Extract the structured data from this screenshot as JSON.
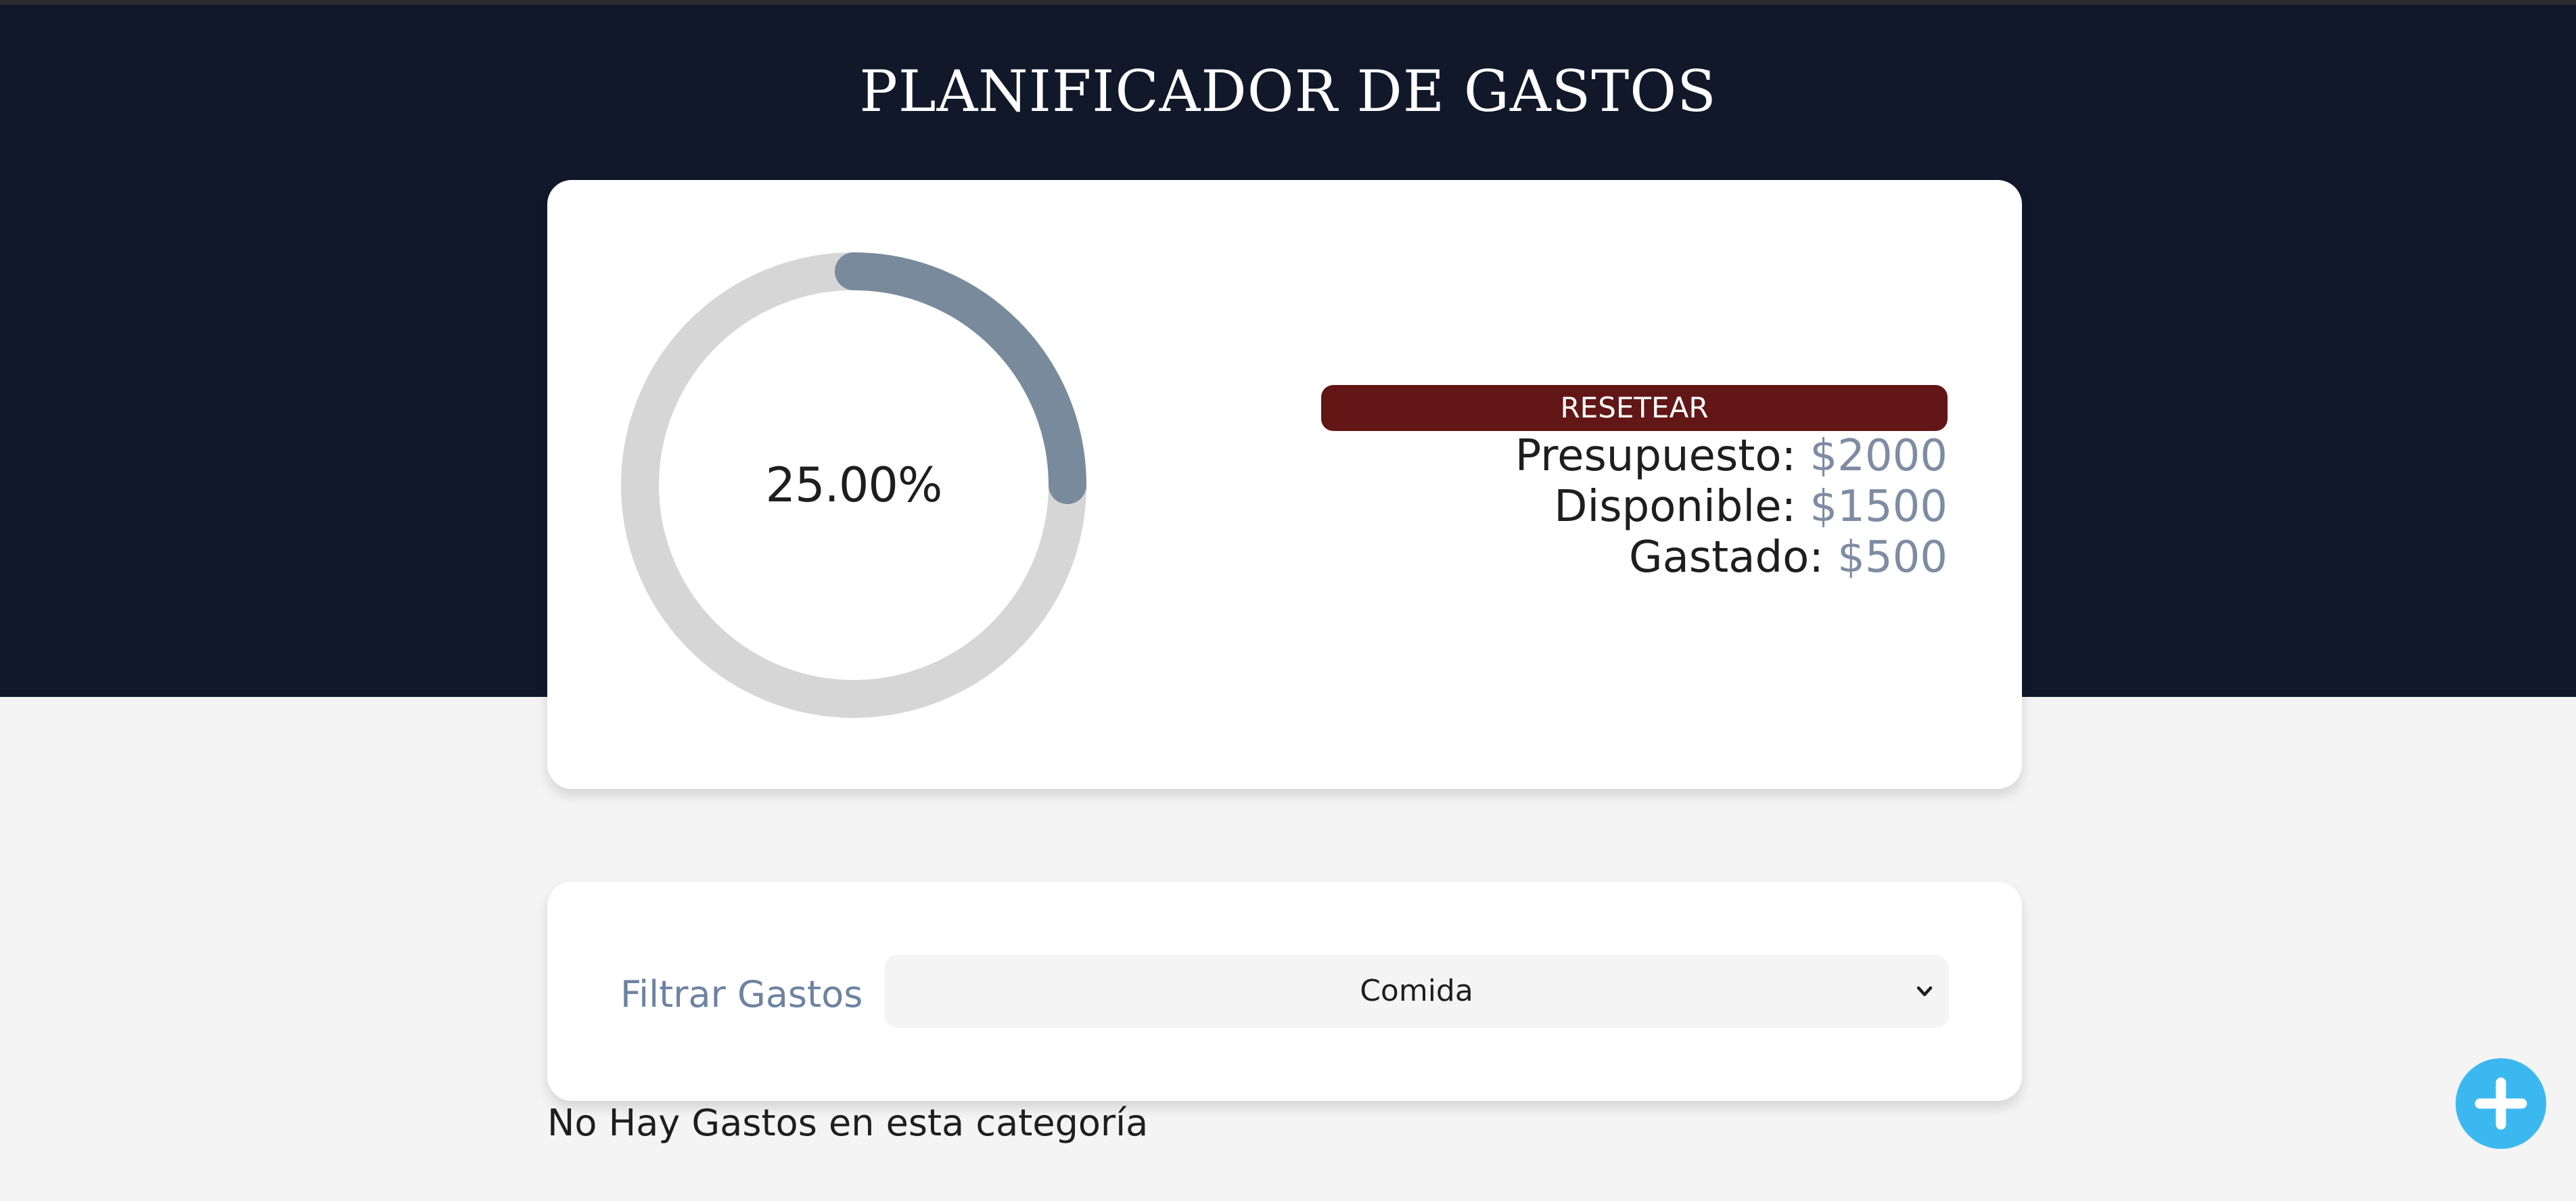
{
  "header": {
    "title": "PLANIFICADOR DE GASTOS"
  },
  "budget": {
    "progress_percent": 25.0,
    "progress_label": "25.00%",
    "reset_label": "RESETEAR",
    "presupuesto_label": "Presupuesto:",
    "presupuesto_value": "$2000",
    "disponible_label": "Disponible:",
    "disponible_value": "$1500",
    "gastado_label": "Gastado:",
    "gastado_value": "$500"
  },
  "filter": {
    "label": "Filtrar Gastos",
    "selected": "Comida"
  },
  "expenses": {
    "empty_message": "No Hay Gastos en esta categoría"
  },
  "colors": {
    "header_bg": "#11182a",
    "progress_track": "#d6d6d6",
    "progress_fill": "#788b9c",
    "reset_button": "#631616",
    "amount_text": "#7e8ca3",
    "add_button": "#3cb8f0"
  },
  "icons": {
    "add": "plus-icon",
    "select": "chevron-down-icon"
  }
}
